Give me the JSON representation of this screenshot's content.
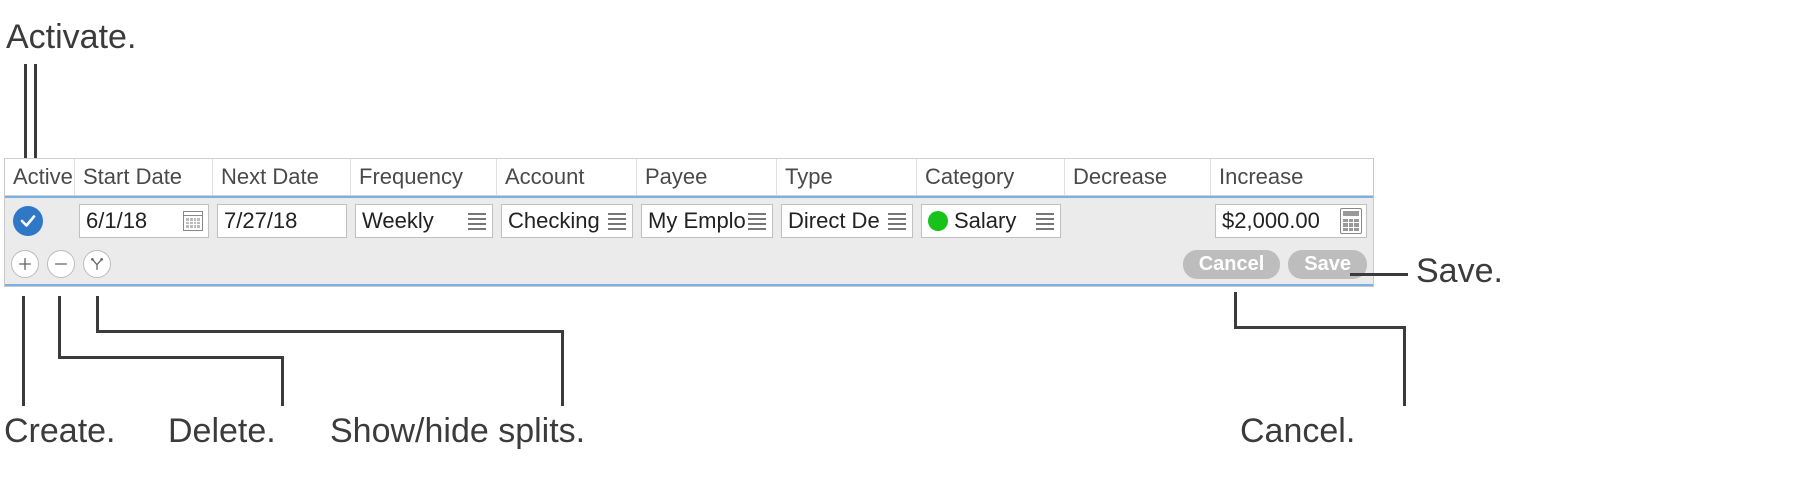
{
  "callouts": {
    "activate": "Activate.",
    "create": "Create.",
    "delete": "Delete.",
    "splits": "Show/hide splits.",
    "save": "Save.",
    "cancel": "Cancel."
  },
  "headers": {
    "active": "Active",
    "start_date": "Start Date",
    "next_date": "Next Date",
    "frequency": "Frequency",
    "account": "Account",
    "payee": "Payee",
    "type": "Type",
    "category": "Category",
    "decrease": "Decrease",
    "increase": "Increase"
  },
  "row": {
    "start_date": "6/1/18",
    "next_date": "7/27/18",
    "frequency": "Weekly",
    "account": "Checking",
    "payee": "My Emplo",
    "type": "Direct De",
    "category": "Salary",
    "decrease": "",
    "increase": "$2,000.00",
    "active": true,
    "category_color": "#17c21a"
  },
  "buttons": {
    "cancel": "Cancel",
    "save": "Save"
  }
}
